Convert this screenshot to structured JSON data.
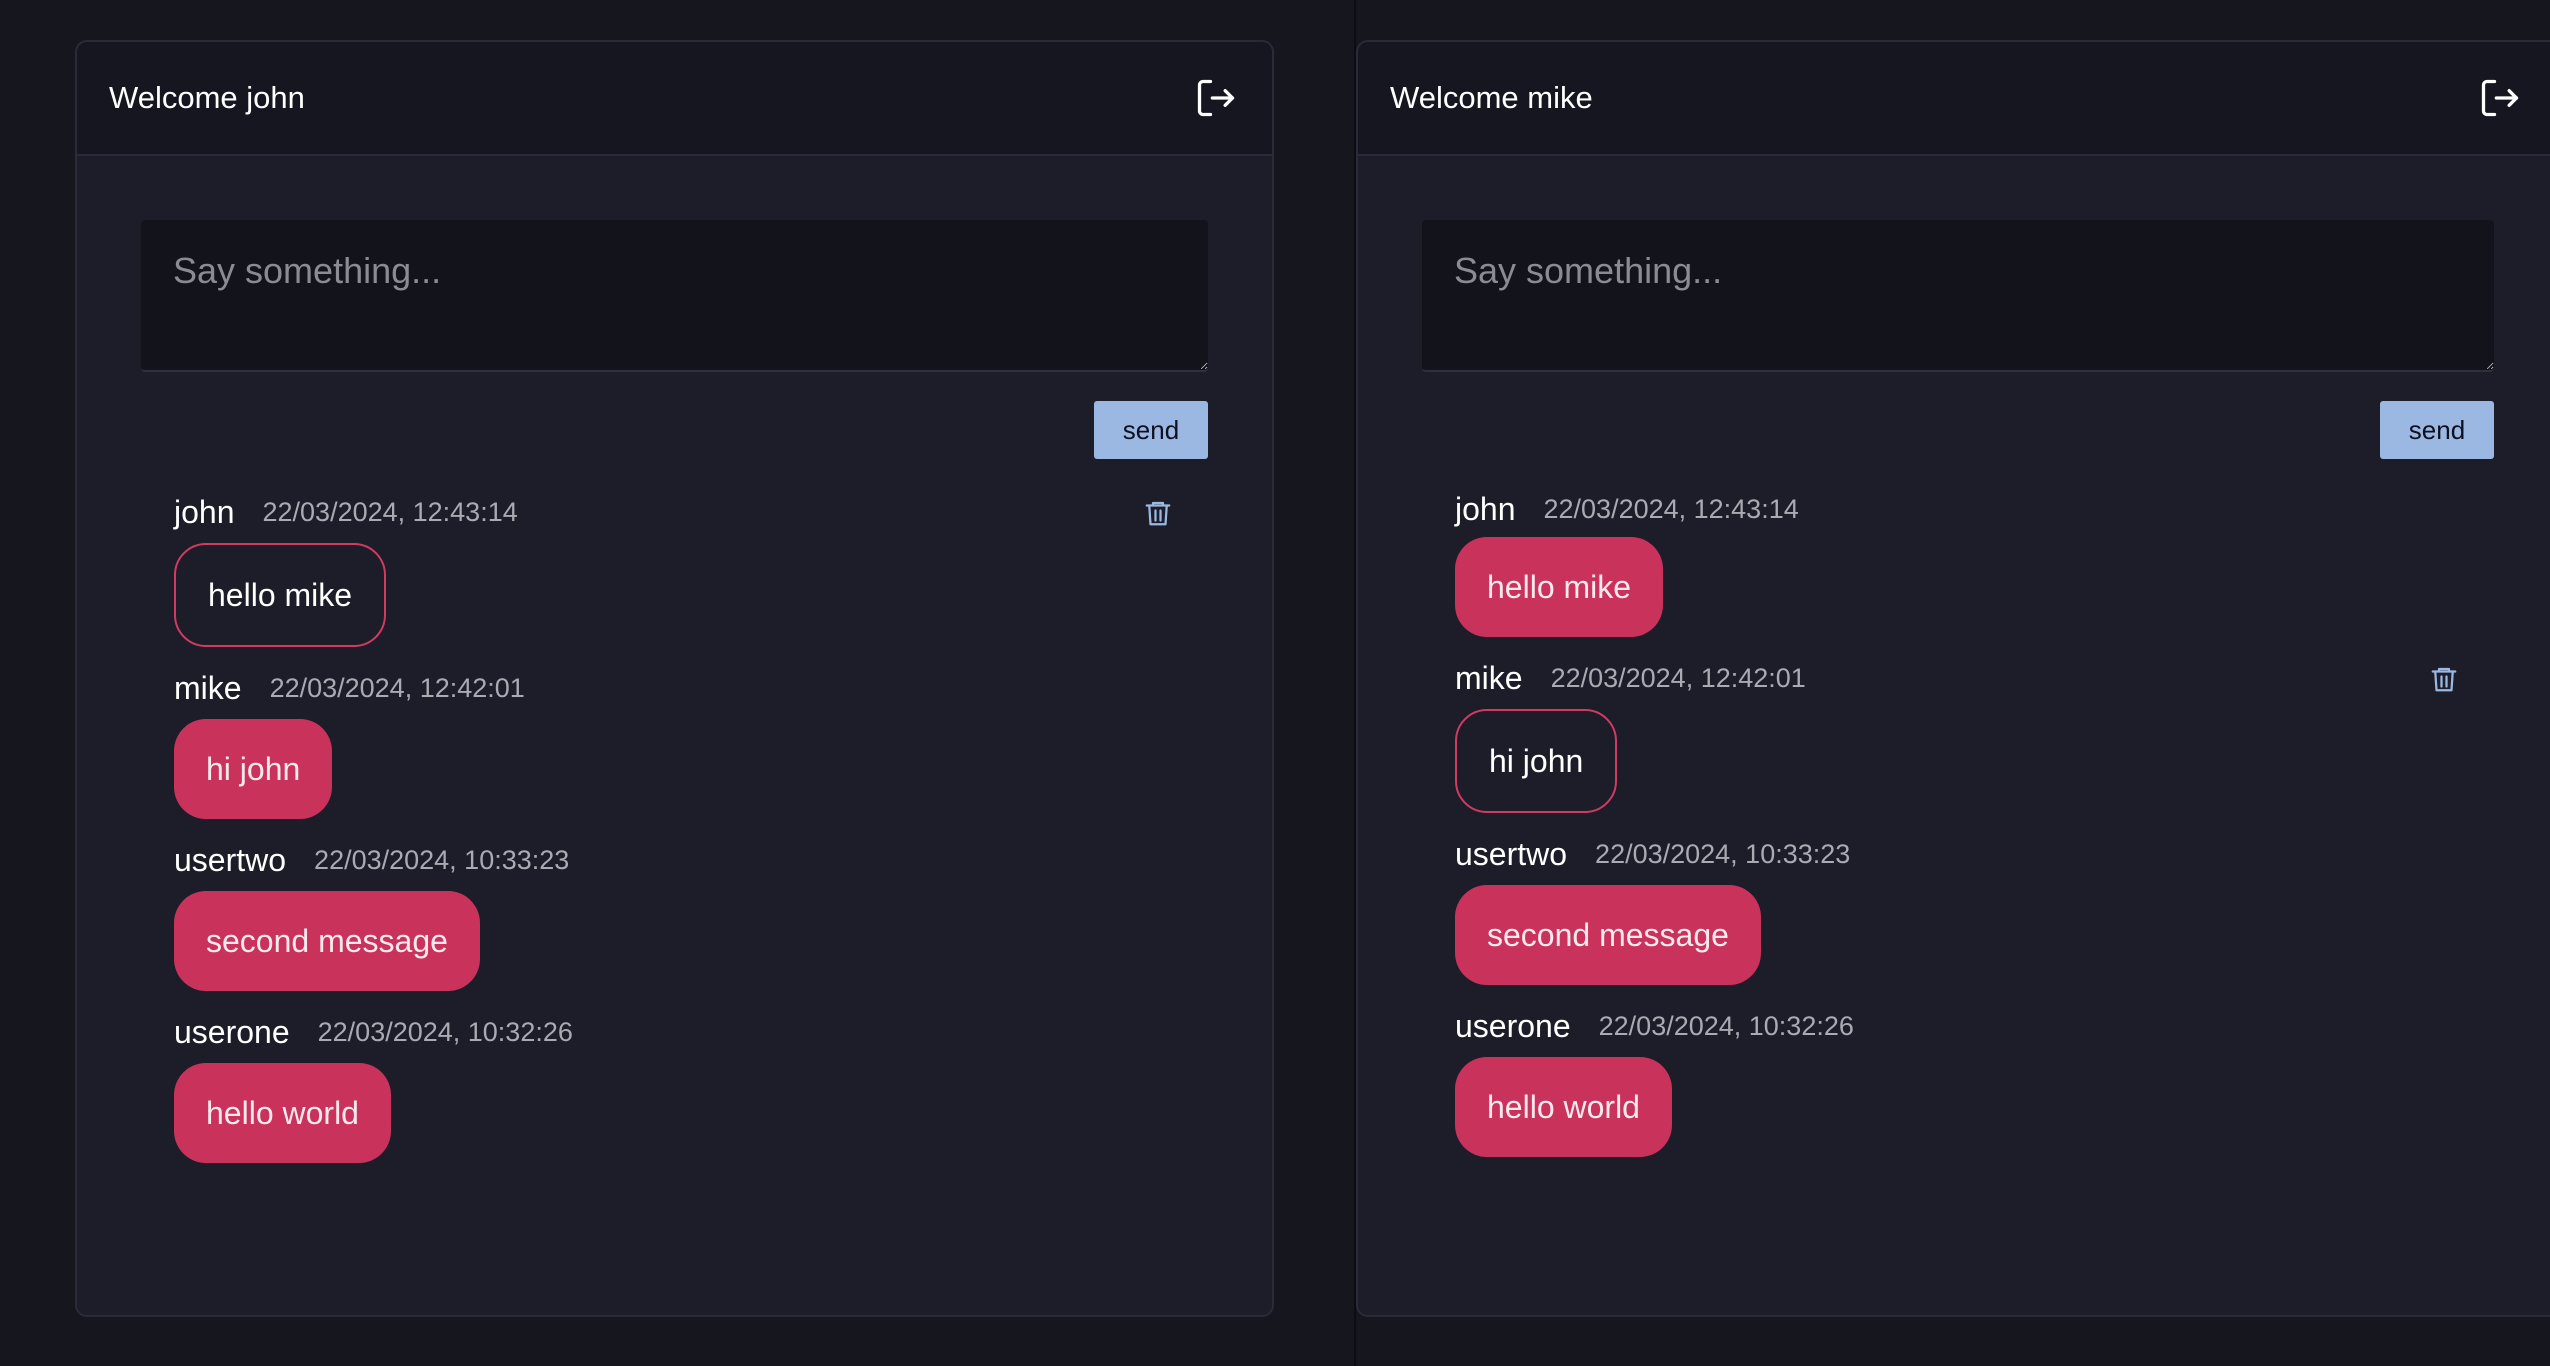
{
  "left": {
    "title": "Welcome john",
    "composer_placeholder": "Say something...",
    "send_label": "send",
    "messages": [
      {
        "author": "john",
        "time": "22/03/2024, 12:43:14",
        "text": "hello mike"
      },
      {
        "author": "mike",
        "time": "22/03/2024, 12:42:01",
        "text": "hi john"
      },
      {
        "author": "usertwo",
        "time": "22/03/2024, 10:33:23",
        "text": "second message"
      },
      {
        "author": "userone",
        "time": "22/03/2024, 10:32:26",
        "text": "hello world"
      }
    ]
  },
  "right": {
    "title": "Welcome mike",
    "composer_placeholder": "Say something...",
    "send_label": "send",
    "messages": [
      {
        "author": "john",
        "time": "22/03/2024, 12:43:14",
        "text": "hello mike"
      },
      {
        "author": "mike",
        "time": "22/03/2024, 12:42:01",
        "text": "hi john"
      },
      {
        "author": "usertwo",
        "time": "22/03/2024, 10:33:23",
        "text": "second message"
      },
      {
        "author": "userone",
        "time": "22/03/2024, 10:32:26",
        "text": "hello world"
      }
    ]
  },
  "icons": {
    "logout": "logout-icon",
    "delete": "trash-icon"
  },
  "colors": {
    "accent_bubble": "#c9325b",
    "send_button": "#9bb8e3",
    "background": "#15161e",
    "card": "#1c1d28"
  }
}
